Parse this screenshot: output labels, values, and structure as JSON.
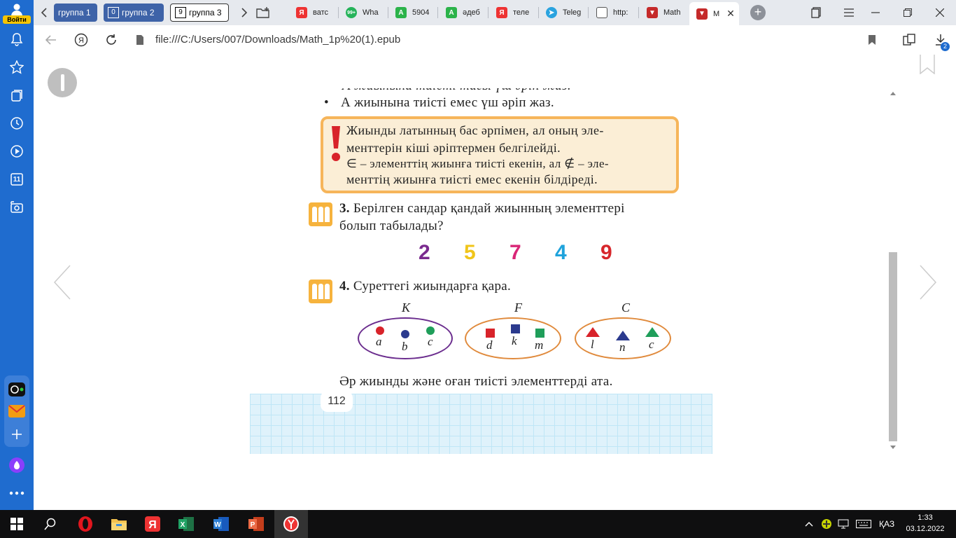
{
  "tabbar": {
    "login_label": "Войти",
    "groups": [
      {
        "count": "",
        "label": "группа 1"
      },
      {
        "count": "0",
        "label": "группа 2"
      },
      {
        "count": "9",
        "label": "группа 3"
      }
    ],
    "tabs": [
      {
        "label": "ватс",
        "icon": "yandex-icon",
        "color": "#e33"
      },
      {
        "label": "Wha",
        "icon": "whatsapp-icon",
        "color": "#25b35a"
      },
      {
        "label": "5904",
        "icon": "a-icon",
        "color": "#2bb34a"
      },
      {
        "label": "әдеб",
        "icon": "a-icon",
        "color": "#2bb34a"
      },
      {
        "label": "теле",
        "icon": "yandex-icon",
        "color": "#e33"
      },
      {
        "label": "Teleg",
        "icon": "telegram-icon",
        "color": "#2aa3df"
      },
      {
        "label": "http:",
        "icon": "file-icon",
        "color": "#555"
      },
      {
        "label": "Math",
        "icon": "epub-icon",
        "color": "#c52a2a"
      },
      {
        "label": "M",
        "icon": "epub-icon",
        "color": "#c52a2a"
      }
    ]
  },
  "address": {
    "url": "file:///C:/Users/007/Downloads/Math_1p%20(1).epub"
  },
  "downloads_badge": "2",
  "sidebar": {
    "badge_11": "11"
  },
  "page": {
    "line_cut": "А жиынына тиісті тағы үш әріп жаз.",
    "line_bullet": "А жиынына тиісті емес үш әріп жаз.",
    "note_lines": [
      "Жиынды латынның бас әрпімен, ал оның эле-",
      "менттерін кіші әріптермен белгілейді.",
      "∈ – элементтің жиынға тиісті екенін, ал ∉ – эле-",
      "менттің жиынға тиісті емес екенін білдіреді."
    ],
    "task3_num": "3.",
    "task3_line1": "Берілген сандар қандай жиынның элементтері",
    "task3_line2": "болып табылады?",
    "numbers": [
      {
        "value": "2",
        "color": "#7a2a8e"
      },
      {
        "value": "5",
        "color": "#f0c51a"
      },
      {
        "value": "7",
        "color": "#d92677"
      },
      {
        "value": "4",
        "color": "#1fa3dc"
      },
      {
        "value": "9",
        "color": "#d7262b"
      }
    ],
    "task4_num": "4.",
    "task4_text": "Суреттегі жиындарға қара.",
    "sets": [
      {
        "name": "K",
        "elements": [
          "a",
          "b",
          "c"
        ],
        "color": "#6b2d8e"
      },
      {
        "name": "F",
        "elements": [
          "d",
          "k",
          "m"
        ],
        "color": "#e08a3c"
      },
      {
        "name": "C",
        "elements": [
          "l",
          "n",
          "c"
        ],
        "color": "#e08a3c"
      }
    ],
    "closing": "Әр жиынды және оған тиісті элементтерді ата.",
    "page_number": "112"
  },
  "taskbar": {
    "lang": "ҚАЗ",
    "time": "1:33",
    "date": "03.12.2022"
  }
}
